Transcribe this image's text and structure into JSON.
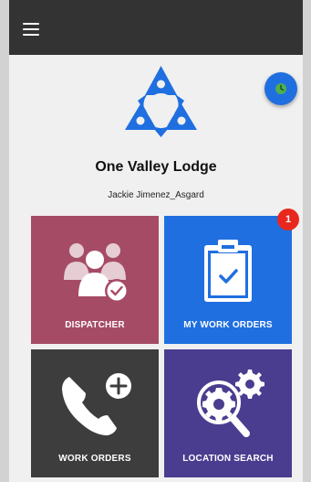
{
  "header": {
    "menu_icon": "hamburger-menu-icon",
    "status_icon": "clock-icon"
  },
  "site": {
    "name": "One Valley Lodge",
    "user": "Jackie Jimenez_Asgard"
  },
  "tiles": [
    {
      "label": "DISPATCHER",
      "color": "#a64b66",
      "icon": "people-check-icon"
    },
    {
      "label": "MY WORK ORDERS",
      "color": "#1f6fe0",
      "icon": "clipboard-check-icon",
      "badge": "1"
    },
    {
      "label": "WORK ORDERS",
      "color": "#3d3d3d",
      "icon": "phone-plus-icon"
    },
    {
      "label": "LOCATION SEARCH",
      "color": "#4a3d8f",
      "icon": "gear-search-icon"
    }
  ],
  "colors": {
    "topbar": "#333333",
    "brand_blue": "#1f6fe0",
    "badge_red": "#e8281e",
    "background": "#f0f0f0"
  }
}
